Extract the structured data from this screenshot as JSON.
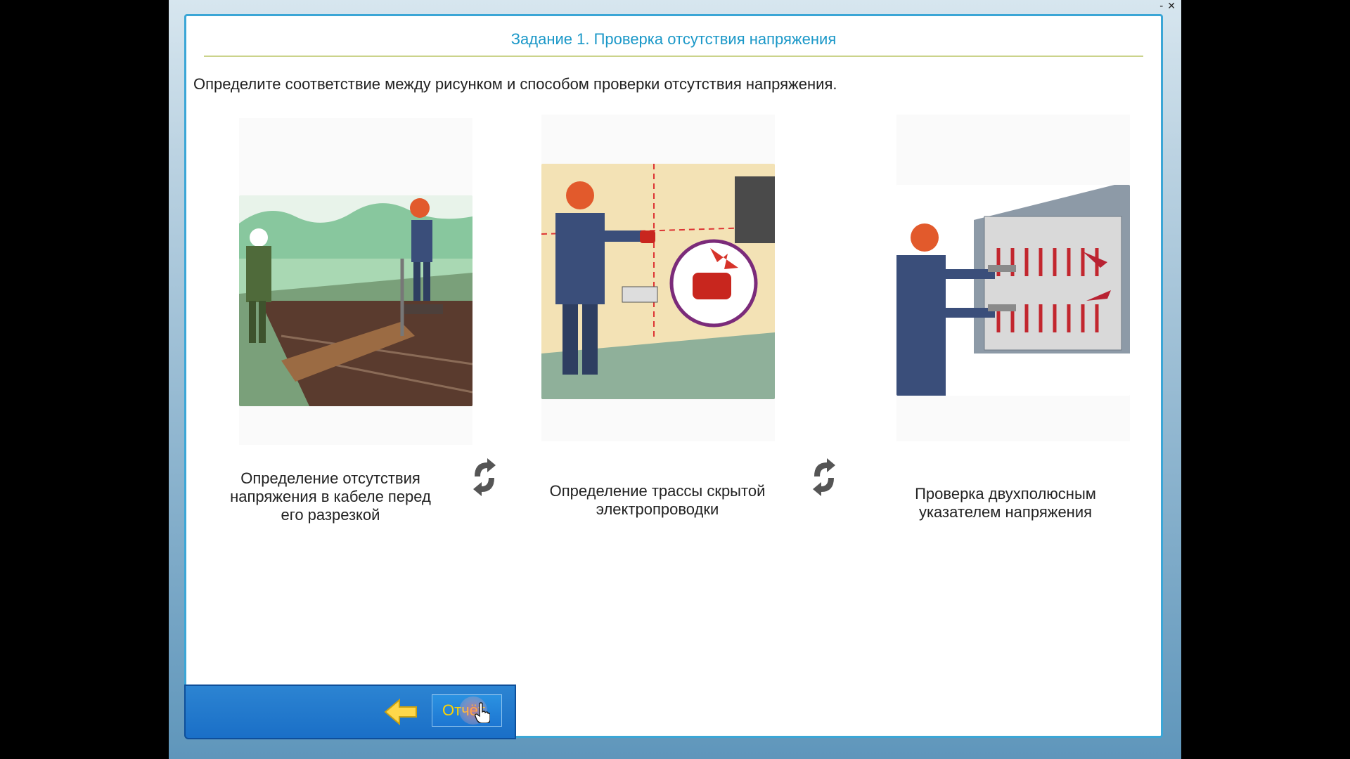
{
  "window": {
    "minimize_label": "-",
    "close_label": "✕"
  },
  "task": {
    "title": "Задание 1. Проверка отсутствия напряжения",
    "instruction": "Определите соответствие между рисунком и способом проверки отсутствия напряжения."
  },
  "images": [
    {
      "icon": "cable-trench-illustration"
    },
    {
      "icon": "hidden-wiring-detector-illustration"
    },
    {
      "icon": "electrical-panel-tester-illustration"
    }
  ],
  "captions": [
    {
      "line1": "Определение отсутствия",
      "line2": "напряжения в кабеле перед",
      "line3": "его разрезкой"
    },
    {
      "line1": "Определение трассы скрытой",
      "line2": "электропроводки"
    },
    {
      "line1": "Проверка двухполюсным",
      "line2": "указателем напряжения"
    }
  ],
  "bottom_bar": {
    "report_label": "Отчёт"
  },
  "colors": {
    "accent": "#1b98c8",
    "border": "#3ba6d6",
    "rule": "#cbd38b",
    "bar": "#1a6fc7",
    "button_text": "#ffd400"
  }
}
